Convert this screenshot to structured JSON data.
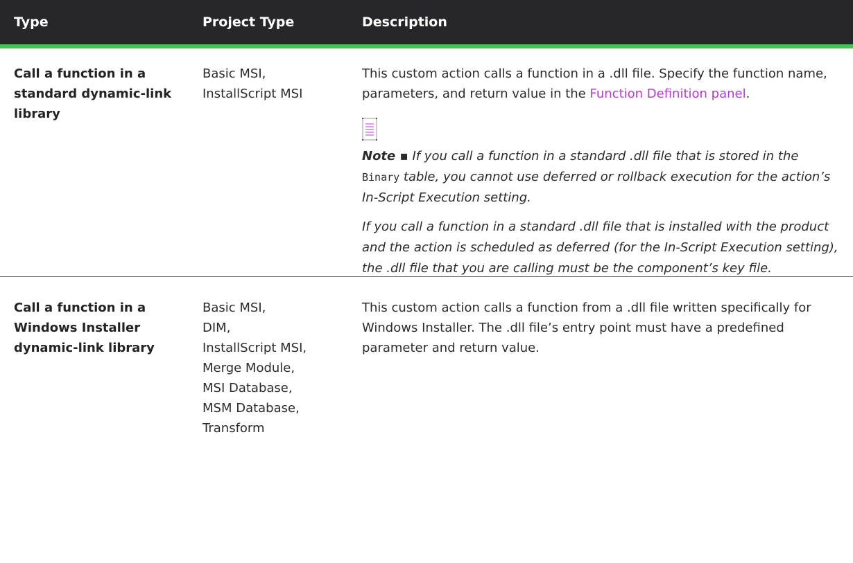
{
  "headers": {
    "type": "Type",
    "project_type": "Project Type",
    "description": "Description"
  },
  "colors": {
    "header_bg": "#27272a",
    "header_accent": "#3fc75a",
    "link": "#b53ad3"
  },
  "rows": [
    {
      "type": "Call a function in a standard dynamic-link library",
      "project_types": [
        "Basic MSI,",
        "InstallScript MSI"
      ],
      "description": {
        "text_before": "This custom action calls a function in a .dll file. Specify the function name, parameters, and return value in the ",
        "link": "Function Definition panel",
        "text_after": "."
      },
      "note": {
        "icon": "note-icon",
        "label": "Note ▪",
        "p1_before": " If you call a function in a standard .dll file that is stored in the ",
        "p1_code": "Binary",
        "p1_after": " table, you cannot use deferred or rollback execution for the action’s In-Script Execution setting.",
        "p2": "If you call a function in a standard .dll file that is installed with the product and the action is scheduled as deferred (for the In-Script Execution setting), the .dll file that you are calling must be the component’s key file."
      }
    },
    {
      "type": "Call a function in a Windows Installer dynamic-link library",
      "project_types": [
        "Basic MSI,",
        "DIM,",
        "InstallScript MSI,",
        "Merge Module,",
        "MSI Database,",
        "MSM Database,",
        "Transform"
      ],
      "description": {
        "text": "This custom action calls a function from a .dll file written specifically for Windows Installer. The .dll file’s entry point must have a predefined parameter and return value."
      }
    }
  ]
}
